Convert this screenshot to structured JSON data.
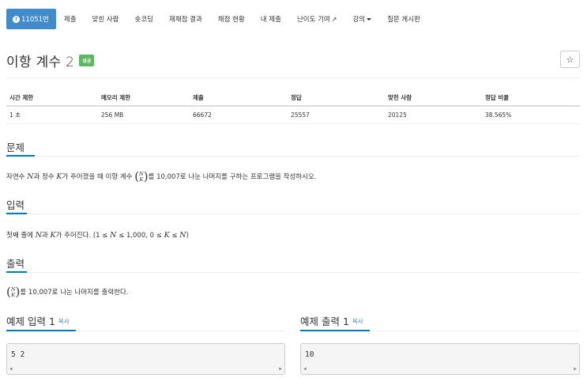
{
  "nav": {
    "problem_number": "11051번",
    "items": [
      "제출",
      "맞힌 사람",
      "숏코딩",
      "재채점 결과",
      "채점 현황",
      "내 제출",
      "난이도 기여",
      "강의",
      "질문 게시판"
    ]
  },
  "header": {
    "title": "이항 계수 2",
    "result_badge": "성공",
    "star_label": "☆"
  },
  "info_table": {
    "headers": [
      "시간 제한",
      "메모리 제한",
      "제출",
      "정답",
      "맞힌 사람",
      "정답 비율"
    ],
    "values": [
      "1 초",
      "256 MB",
      "66672",
      "25557",
      "20125",
      "38.565%"
    ]
  },
  "problem": {
    "heading": "문제",
    "text_1": "자연수 ",
    "var_n": "N",
    "text_2": "과 정수 ",
    "var_k": "K",
    "text_3": "가 주어졌을 때 이항 계수 ",
    "text_4": "를 10,007로 나눈 나머지를 구하는 프로그램을 작성하시오."
  },
  "input": {
    "heading": "입력",
    "text_1": "첫째 줄에 ",
    "var_n": "N",
    "text_2": "과 ",
    "var_k": "K",
    "text_3": "가 주어진다. (1 ≤ ",
    "text_4": " ≤ 1,000, 0 ≤ ",
    "text_5": " ≤ ",
    "text_6": ")"
  },
  "output": {
    "heading": "출력",
    "text_1": "를 10,007로 나눈 나머지를 출력한다."
  },
  "examples": {
    "input_title": "예제 입력 1",
    "output_title": "예제 출력 1",
    "copy_label": "복사",
    "input_value": "5 2",
    "output_value": "10"
  },
  "colors": {
    "nav_active": "#428bca",
    "success_badge": "#5cb85c",
    "section_underline": "#0076c0",
    "copy_link": "#428bca"
  }
}
